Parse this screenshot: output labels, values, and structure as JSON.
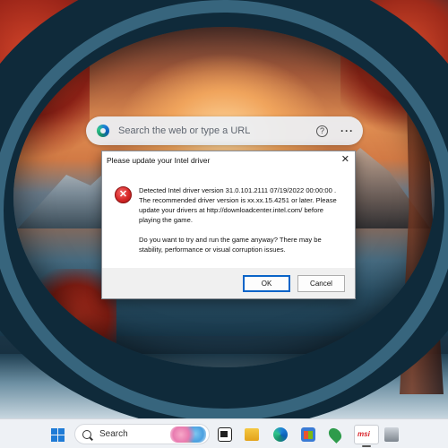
{
  "browser": {
    "search_placeholder": "Search the web or type a URL",
    "help_glyph": "?",
    "more_glyph": "···"
  },
  "dialog": {
    "title": "Please update your Intel  driver",
    "close_glyph": "✕",
    "error_glyph": "✕",
    "message_1": "Detected Intel  driver version 31.0.101.2111 07/19/2022 00:00:00 . The recommended driver version is xx.xx.15.4251 or later. Please update your drivers at http://downloadcenter.intel.com/ before playing the game.",
    "message_2": "Do you want to try and run the game anyway? There may be stability, performance or visual corruption issues.",
    "ok_label": "OK",
    "cancel_label": "Cancel"
  },
  "taskbar": {
    "search_label": "Search",
    "msi_label": "msi",
    "icons": [
      "start-icon",
      "search-icon",
      "task-view-icon",
      "file-explorer-icon",
      "edge-icon",
      "store-icon",
      "leaf-app-icon",
      "msi-app-icon",
      "tool-app-icon"
    ]
  },
  "colors": {
    "accent": "#0a64c8",
    "error": "#d62828",
    "taskbar_bg": "#eef1f5"
  }
}
